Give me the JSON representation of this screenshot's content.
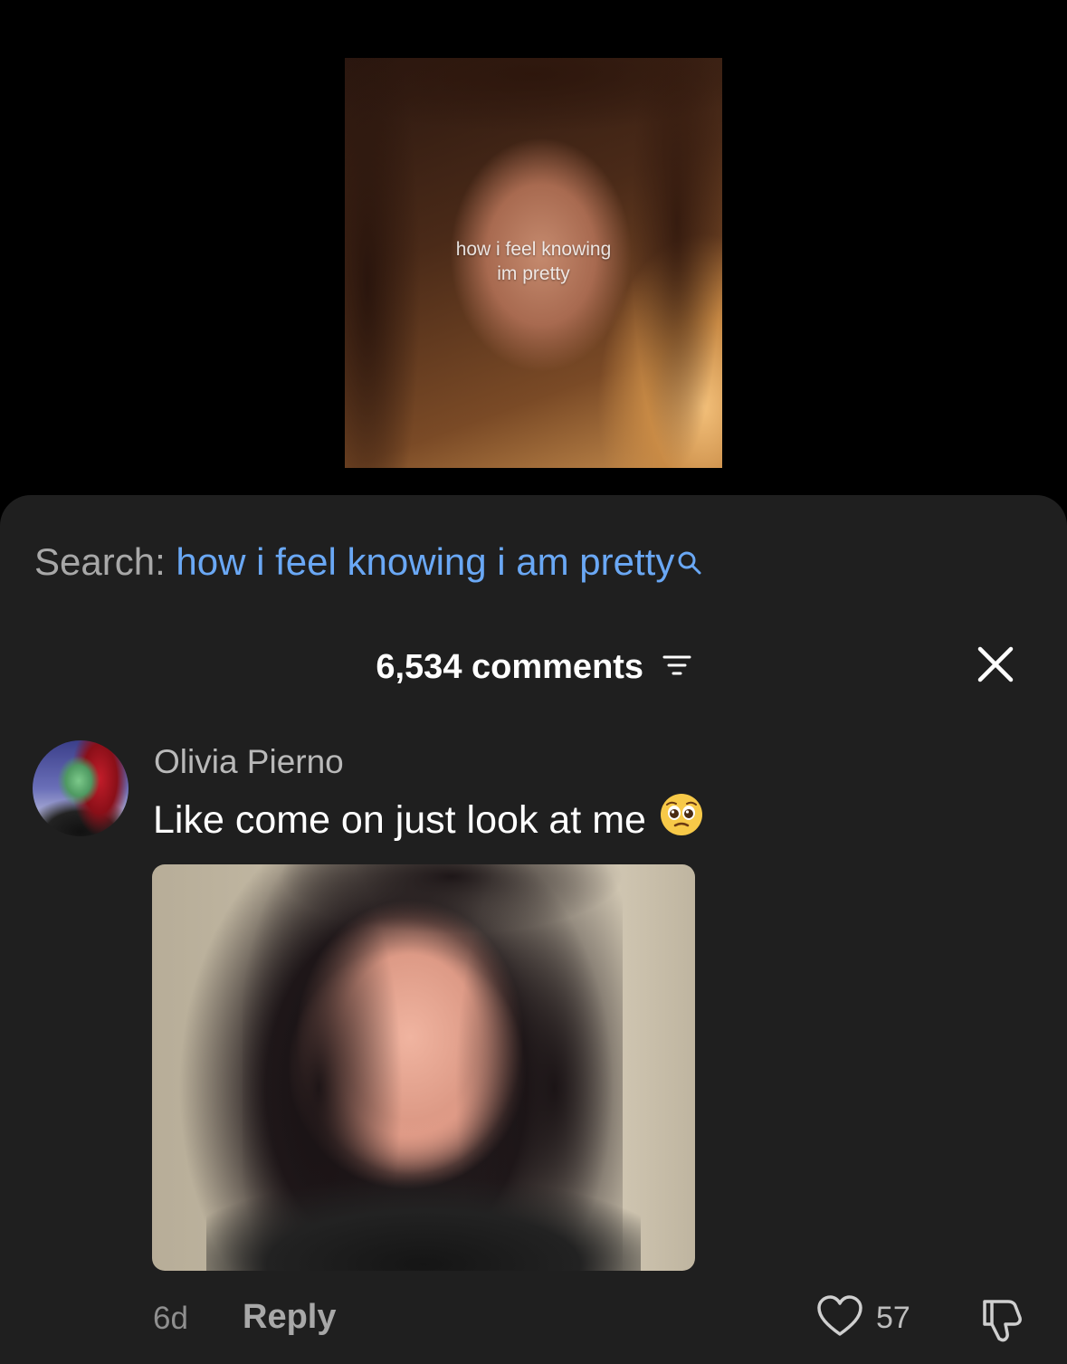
{
  "video": {
    "caption_line1": "how i feel knowing",
    "caption_line2": "im pretty"
  },
  "search": {
    "label": "Search:",
    "query": "how i feel knowing i am pretty",
    "icon": "search-icon"
  },
  "comments_panel": {
    "count_label": "6,534 comments",
    "filter_icon": "filter-icon",
    "close_icon": "close-icon"
  },
  "comment": {
    "author": "Olivia Pierno",
    "text": "Like come on just look at me",
    "emoji": "pleading-face-icon",
    "age": "6d",
    "reply_label": "Reply",
    "like_count": "57"
  },
  "colors": {
    "background": "#000000",
    "sheet": "#1f1f1f",
    "search_query": "#6aa8f5",
    "muted_text": "#a8a8a8"
  }
}
